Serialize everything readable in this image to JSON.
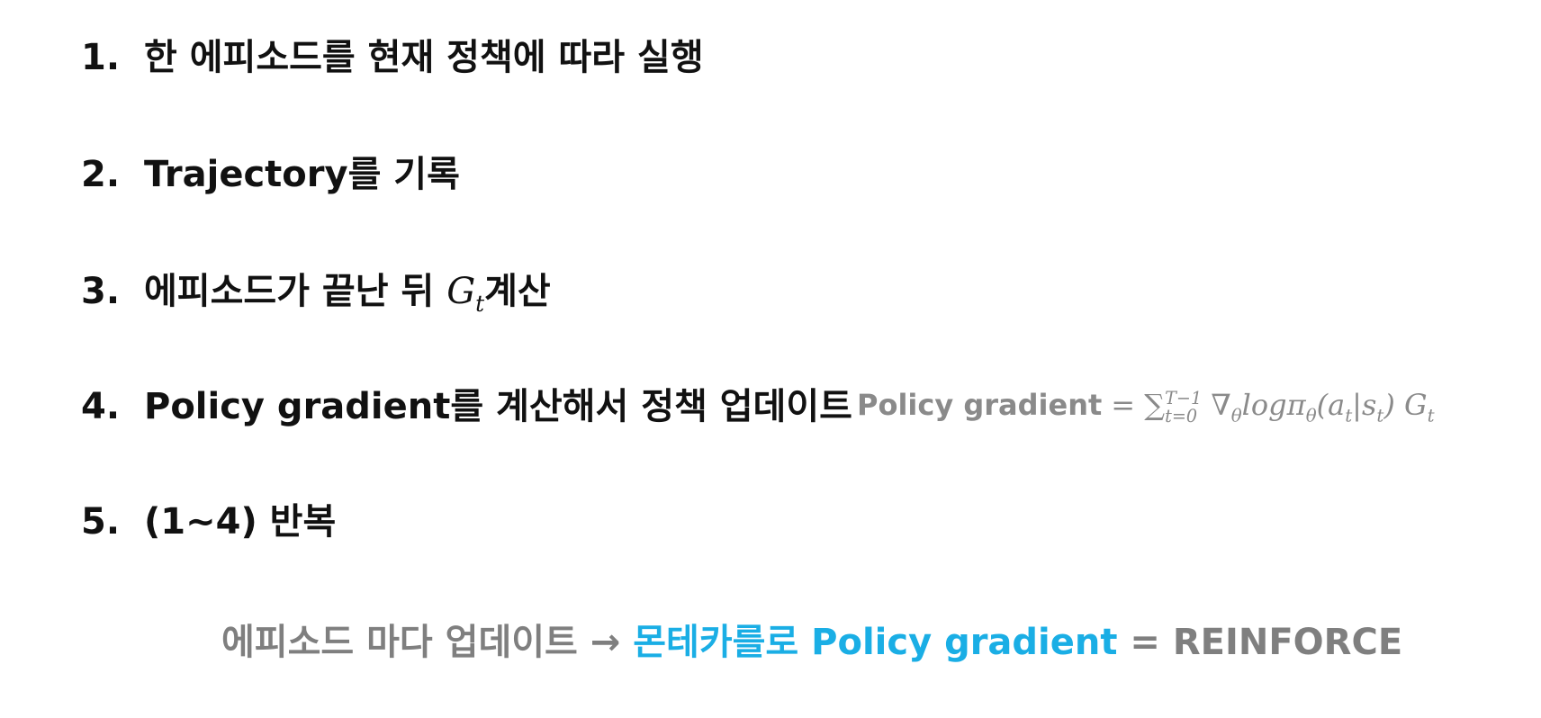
{
  "steps": [
    {
      "number": "1.",
      "text": "한 에피소드를 현재 정책에 따라 실행"
    },
    {
      "number": "2.",
      "text": "Trajectory를 기록"
    },
    {
      "number": "3.",
      "text_before": "에피소드가 끝난 뒤 ",
      "math": "G",
      "math_sub": "t",
      "text_after": "계산"
    },
    {
      "number": "4.",
      "text": "Policy gradient를 계산해서 정책 업데이트"
    },
    {
      "number": "5.",
      "text": "(1~4) 반복"
    }
  ],
  "formula": {
    "label": "Policy gradient",
    "equals": "= ",
    "sum": "∑",
    "sum_sup": "T−1",
    "sum_sub": "t=0",
    "nabla": " ∇",
    "nabla_sub": "θ",
    "log_pi": "logπ",
    "pi_sub": "θ",
    "open_paren": "(a",
    "a_sub": "t",
    "bar_s": "|s",
    "s_sub": "t",
    "close_paren": ") G",
    "g_sub": "t"
  },
  "summary": {
    "prefix": "에피소드 마다 업데이트 → ",
    "highlight": "몬테카를로 Policy gradient",
    "suffix": " = REINFORCE"
  },
  "colors": {
    "text": "#111111",
    "formula_gray": "#8a8a8a",
    "summary_gray": "#7f7f7f",
    "accent_blue": "#1aaee5"
  }
}
